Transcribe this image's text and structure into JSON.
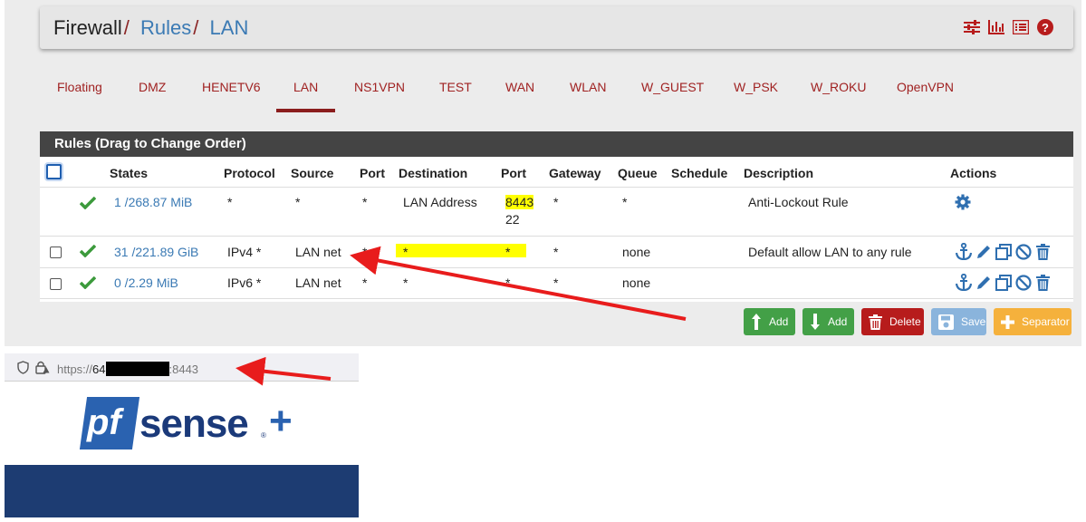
{
  "breadcrumb": {
    "root": "Firewall",
    "sep": "/",
    "rules": "Rules",
    "current": "LAN"
  },
  "header_icons": [
    "sliders-icon",
    "bar-chart-icon",
    "list-icon",
    "help-icon"
  ],
  "tabs": [
    "Floating",
    "DMZ",
    "HENETV6",
    "LAN",
    "NS1VPN",
    "TEST",
    "WAN",
    "WLAN",
    "W_GUEST",
    "W_PSK",
    "W_ROKU",
    "OpenVPN"
  ],
  "active_tab": "LAN",
  "panel": {
    "title": "Rules (Drag to Change Order)"
  },
  "columns": {
    "states": "States",
    "protocol": "Protocol",
    "source": "Source",
    "port": "Port",
    "destination": "Destination",
    "dport": "Port",
    "gateway": "Gateway",
    "queue": "Queue",
    "schedule": "Schedule",
    "description": "Description",
    "actions": "Actions"
  },
  "rows": [
    {
      "states": "1 /268.87 MiB",
      "protocol": "*",
      "source": "*",
      "port": "*",
      "destination": "LAN Address",
      "dport": "8443",
      "dport2": "22",
      "gateway": "*",
      "queue": "*",
      "description": "Anti-Lockout Rule"
    },
    {
      "states": "31 /221.89 GiB",
      "protocol": "IPv4 *",
      "source": "LAN net",
      "port": "*",
      "destination": "*",
      "dport": "*",
      "gateway": "*",
      "queue": "none",
      "description": "Default allow LAN to any rule"
    },
    {
      "states": "0 /2.29 MiB",
      "protocol": "IPv6 *",
      "source": "LAN net",
      "port": "*",
      "destination": "*",
      "dport": "*",
      "gateway": "*",
      "queue": "none",
      "description": ""
    }
  ],
  "buttons": {
    "add_top": "Add",
    "add_bottom": "Add",
    "delete": "Delete",
    "save": "Save",
    "separator": "Separator"
  },
  "url": {
    "scheme": "https://",
    "host": "64",
    "port": ":8443"
  },
  "logo": {
    "pf": "pf",
    "sense": "sense",
    "plus": "+",
    "reg": "®"
  },
  "colors": {
    "accent_red": "#a02222",
    "link_blue": "#3b7ab4",
    "green": "#43a047",
    "header_dark": "#444444",
    "navy": "#1d3c72"
  }
}
